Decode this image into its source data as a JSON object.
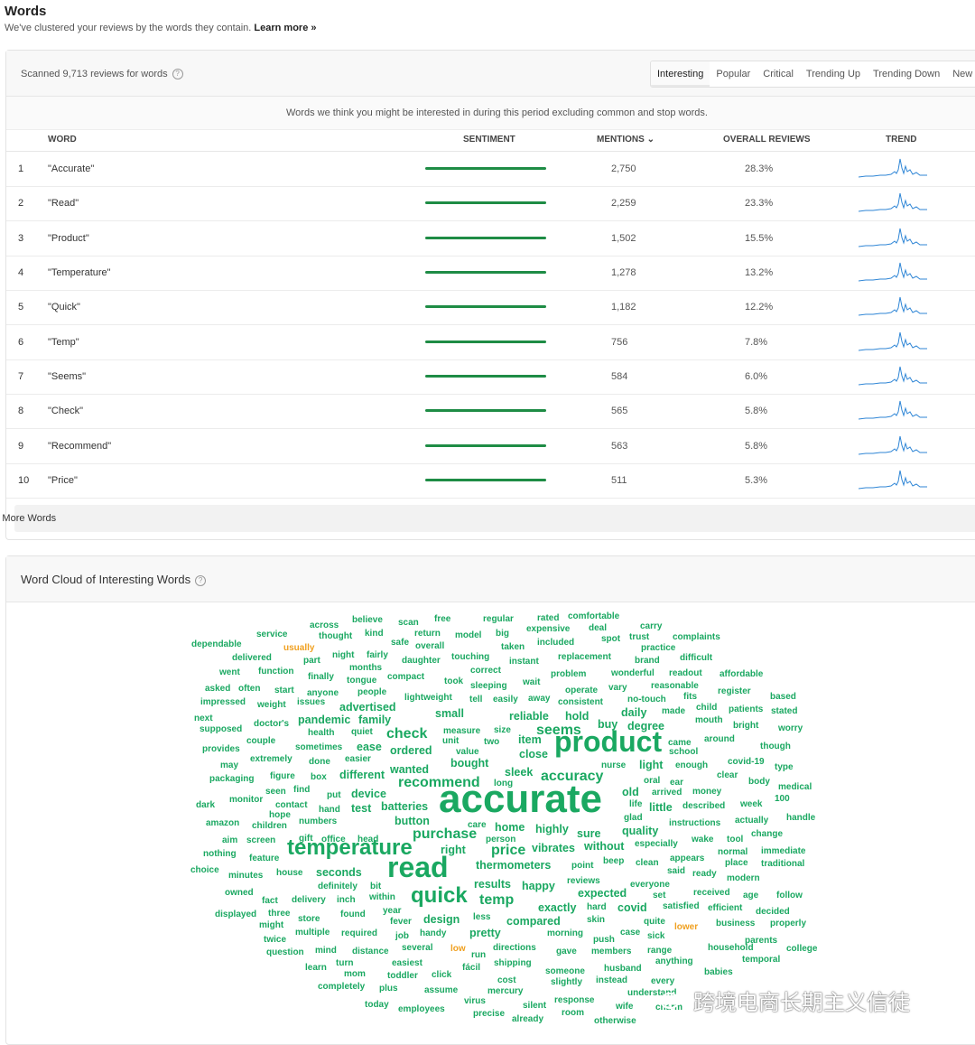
{
  "page": {
    "title": "Words",
    "subtitle": "We've clustered your reviews by the words they contain.",
    "learn_more": "Learn more »"
  },
  "words_panel": {
    "scanned": "Scanned 9,713 reviews for words",
    "help_glyph": "?",
    "tabs": [
      "Interesting",
      "Popular",
      "Critical",
      "Trending Up",
      "Trending Down",
      "New"
    ],
    "active_tab": "Interesting",
    "note": "Words we think you might be interested in during this period excluding common and stop words.",
    "headers": {
      "word": "WORD",
      "sentiment": "SENTIMENT",
      "mentions": "MENTIONS",
      "overall": "OVERALL REVIEWS",
      "trend": "TREND"
    },
    "sort_glyph": "⌄",
    "rows": [
      {
        "n": "1",
        "word": "\"Accurate\"",
        "sentiment": 1.0,
        "mentions": "2,750",
        "overall": "28.3%"
      },
      {
        "n": "2",
        "word": "\"Read\"",
        "sentiment": 1.0,
        "mentions": "2,259",
        "overall": "23.3%"
      },
      {
        "n": "3",
        "word": "\"Product\"",
        "sentiment": 1.0,
        "mentions": "1,502",
        "overall": "15.5%"
      },
      {
        "n": "4",
        "word": "\"Temperature\"",
        "sentiment": 1.0,
        "mentions": "1,278",
        "overall": "13.2%"
      },
      {
        "n": "5",
        "word": "\"Quick\"",
        "sentiment": 1.0,
        "mentions": "1,182",
        "overall": "12.2%"
      },
      {
        "n": "6",
        "word": "\"Temp\"",
        "sentiment": 1.0,
        "mentions": "756",
        "overall": "7.8%"
      },
      {
        "n": "7",
        "word": "\"Seems\"",
        "sentiment": 1.0,
        "mentions": "584",
        "overall": "6.0%"
      },
      {
        "n": "8",
        "word": "\"Check\"",
        "sentiment": 1.0,
        "mentions": "565",
        "overall": "5.8%"
      },
      {
        "n": "9",
        "word": "\"Recommend\"",
        "sentiment": 1.0,
        "mentions": "563",
        "overall": "5.8%"
      },
      {
        "n": "10",
        "word": "\"Price\"",
        "sentiment": 1.0,
        "mentions": "511",
        "overall": "5.3%"
      }
    ],
    "more_button": "Show More Words",
    "colors": {
      "sentiment": "#1e8c45",
      "trend": "#2f86d6"
    }
  },
  "cloud_panel": {
    "title": "Word Cloud of Interesting Words",
    "help_glyph": "?",
    "colors": {
      "positive": "#1aa861",
      "neutral": "#f0a020"
    },
    "words": [
      [
        "across",
        2,
        0
      ],
      [
        "believe",
        2,
        0
      ],
      [
        "scan",
        2,
        0
      ],
      [
        "free",
        2,
        0
      ],
      [
        "regular",
        2,
        0
      ],
      [
        "rated",
        2,
        0
      ],
      [
        "comfortable",
        2,
        0
      ],
      [
        "service",
        2,
        0
      ],
      [
        "thought",
        2,
        0
      ],
      [
        "kind",
        2,
        0
      ],
      [
        "return",
        2,
        0
      ],
      [
        "model",
        2,
        0
      ],
      [
        "big",
        2,
        0
      ],
      [
        "expensive",
        2,
        0
      ],
      [
        "deal",
        2,
        0
      ],
      [
        "carry",
        2,
        0
      ],
      [
        "dependable",
        2,
        0
      ],
      [
        "usually",
        2,
        1
      ],
      [
        "safe",
        2,
        0
      ],
      [
        "overall",
        2,
        0
      ],
      [
        "taken",
        2,
        0
      ],
      [
        "included",
        2,
        0
      ],
      [
        "spot",
        2,
        0
      ],
      [
        "trust",
        2,
        0
      ],
      [
        "complaints",
        2,
        0
      ],
      [
        "delivered",
        2,
        0
      ],
      [
        "night",
        2,
        0
      ],
      [
        "fairly",
        2,
        0
      ],
      [
        "daughter",
        2,
        0
      ],
      [
        "touching",
        2,
        0
      ],
      [
        "instant",
        2,
        0
      ],
      [
        "replacement",
        2,
        0
      ],
      [
        "practice",
        2,
        0
      ],
      [
        "went",
        2,
        0
      ],
      [
        "function",
        2,
        0
      ],
      [
        "months",
        2,
        0
      ],
      [
        "part",
        2,
        0
      ],
      [
        "correct",
        2,
        0
      ],
      [
        "brand",
        2,
        0
      ],
      [
        "difficult",
        2,
        0
      ],
      [
        "finally",
        2,
        0
      ],
      [
        "tongue",
        2,
        0
      ],
      [
        "compact",
        2,
        0
      ],
      [
        "problem",
        2,
        0
      ],
      [
        "wonderful",
        2,
        0
      ],
      [
        "readout",
        2,
        0
      ],
      [
        "affordable",
        2,
        0
      ],
      [
        "asked",
        2,
        0
      ],
      [
        "often",
        2,
        0
      ],
      [
        "start",
        2,
        0
      ],
      [
        "anyone",
        2,
        0
      ],
      [
        "people",
        2,
        0
      ],
      [
        "took",
        2,
        0
      ],
      [
        "sleeping",
        2,
        0
      ],
      [
        "wait",
        2,
        0
      ],
      [
        "operate",
        2,
        0
      ],
      [
        "vary",
        2,
        0
      ],
      [
        "reasonable",
        2,
        0
      ],
      [
        "register",
        2,
        0
      ],
      [
        "impressed",
        2,
        0
      ],
      [
        "weight",
        2,
        0
      ],
      [
        "issues",
        2,
        0
      ],
      [
        "lightweight",
        2,
        0
      ],
      [
        "tell",
        2,
        0
      ],
      [
        "easily",
        2,
        0
      ],
      [
        "away",
        2,
        0
      ],
      [
        "consistent",
        2,
        0
      ],
      [
        "no-touch",
        2,
        0
      ],
      [
        "fits",
        2,
        0
      ],
      [
        "based",
        2,
        0
      ],
      [
        "next",
        2,
        0
      ],
      [
        "pandemic",
        3,
        0
      ],
      [
        "family",
        3,
        0
      ],
      [
        "advertised",
        3,
        0
      ],
      [
        "small",
        3,
        0
      ],
      [
        "reliable",
        3,
        0
      ],
      [
        "hold",
        3,
        0
      ],
      [
        "daily",
        3,
        0
      ],
      [
        "made",
        2,
        0
      ],
      [
        "child",
        2,
        0
      ],
      [
        "patients",
        2,
        0
      ],
      [
        "stated",
        2,
        0
      ],
      [
        "supposed",
        2,
        0
      ],
      [
        "doctor's",
        2,
        0
      ],
      [
        "health",
        2,
        0
      ],
      [
        "quiet",
        2,
        0
      ],
      [
        "measure",
        2,
        0
      ],
      [
        "size",
        2,
        0
      ],
      [
        "buy",
        3,
        0
      ],
      [
        "degree",
        3,
        0
      ],
      [
        "mouth",
        2,
        0
      ],
      [
        "bright",
        2,
        0
      ],
      [
        "worry",
        2,
        0
      ],
      [
        "couple",
        2,
        0
      ],
      [
        "check",
        4,
        0
      ],
      [
        "unit",
        2,
        0
      ],
      [
        "two",
        2,
        0
      ],
      [
        "item",
        3,
        0
      ],
      [
        "seems",
        4,
        0
      ],
      [
        "came",
        2,
        0
      ],
      [
        "around",
        2,
        0
      ],
      [
        "provides",
        2,
        0
      ],
      [
        "sometimes",
        2,
        0
      ],
      [
        "ease",
        3,
        0
      ],
      [
        "ordered",
        3,
        0
      ],
      [
        "value",
        2,
        0
      ],
      [
        "close",
        3,
        0
      ],
      [
        "product",
        6,
        0
      ],
      [
        "school",
        2,
        0
      ],
      [
        "though",
        2,
        0
      ],
      [
        "extremely",
        2,
        0
      ],
      [
        "done",
        2,
        0
      ],
      [
        "easier",
        2,
        0
      ],
      [
        "bought",
        3,
        0
      ],
      [
        "nurse",
        2,
        0
      ],
      [
        "light",
        3,
        0
      ],
      [
        "enough",
        2,
        0
      ],
      [
        "covid-19",
        2,
        0
      ],
      [
        "may",
        2,
        0
      ],
      [
        "different",
        3,
        0
      ],
      [
        "wanted",
        3,
        0
      ],
      [
        "sleek",
        3,
        0
      ],
      [
        "accuracy",
        4,
        0
      ],
      [
        "clear",
        2,
        0
      ],
      [
        "type",
        2,
        0
      ],
      [
        "packaging",
        2,
        0
      ],
      [
        "figure",
        2,
        0
      ],
      [
        "box",
        2,
        0
      ],
      [
        "recommend",
        4,
        0
      ],
      [
        "long",
        2,
        0
      ],
      [
        "oral",
        2,
        0
      ],
      [
        "ear",
        2,
        0
      ],
      [
        "body",
        2,
        0
      ],
      [
        "medical",
        2,
        0
      ],
      [
        "seen",
        2,
        0
      ],
      [
        "find",
        2,
        0
      ],
      [
        "put",
        2,
        0
      ],
      [
        "device",
        3,
        0
      ],
      [
        "old",
        3,
        0
      ],
      [
        "arrived",
        2,
        0
      ],
      [
        "money",
        2,
        0
      ],
      [
        "dark",
        2,
        0
      ],
      [
        "monitor",
        2,
        0
      ],
      [
        "contact",
        2,
        0
      ],
      [
        "batteries",
        3,
        0
      ],
      [
        "life",
        2,
        0
      ],
      [
        "little",
        3,
        0
      ],
      [
        "described",
        2,
        0
      ],
      [
        "week",
        2,
        0
      ],
      [
        "100",
        2,
        0
      ],
      [
        "hope",
        2,
        0
      ],
      [
        "hand",
        2,
        0
      ],
      [
        "test",
        3,
        0
      ],
      [
        "accurate",
        7,
        0
      ],
      [
        "glad",
        2,
        0
      ],
      [
        "instructions",
        2,
        0
      ],
      [
        "actually",
        2,
        0
      ],
      [
        "handle",
        2,
        0
      ],
      [
        "amazon",
        2,
        0
      ],
      [
        "children",
        2,
        0
      ],
      [
        "numbers",
        2,
        0
      ],
      [
        "button",
        3,
        0
      ],
      [
        "home",
        3,
        0
      ],
      [
        "care",
        2,
        0
      ],
      [
        "highly",
        3,
        0
      ],
      [
        "quality",
        3,
        0
      ],
      [
        "change",
        2,
        0
      ],
      [
        "aim",
        2,
        0
      ],
      [
        "screen",
        2,
        0
      ],
      [
        "gift",
        2,
        0
      ],
      [
        "office",
        2,
        0
      ],
      [
        "head",
        2,
        0
      ],
      [
        "purchase",
        4,
        0
      ],
      [
        "person",
        2,
        0
      ],
      [
        "sure",
        3,
        0
      ],
      [
        "especially",
        2,
        0
      ],
      [
        "wake",
        2,
        0
      ],
      [
        "tool",
        2,
        0
      ],
      [
        "nothing",
        2,
        0
      ],
      [
        "feature",
        2,
        0
      ],
      [
        "temperature",
        5,
        0
      ],
      [
        "right",
        3,
        0
      ],
      [
        "price",
        4,
        0
      ],
      [
        "vibrates",
        3,
        0
      ],
      [
        "without",
        3,
        0
      ],
      [
        "normal",
        2,
        0
      ],
      [
        "immediate",
        2,
        0
      ],
      [
        "choice",
        2,
        0
      ],
      [
        "minutes",
        2,
        0
      ],
      [
        "house",
        2,
        0
      ],
      [
        "seconds",
        3,
        0
      ],
      [
        "thermometers",
        3,
        0
      ],
      [
        "point",
        2,
        0
      ],
      [
        "beep",
        2,
        0
      ],
      [
        "clean",
        2,
        0
      ],
      [
        "appears",
        2,
        0
      ],
      [
        "place",
        2,
        0
      ],
      [
        "traditional",
        2,
        0
      ],
      [
        "owned",
        2,
        0
      ],
      [
        "definitely",
        2,
        0
      ],
      [
        "bit",
        2,
        0
      ],
      [
        "read",
        6,
        0
      ],
      [
        "reviews",
        2,
        0
      ],
      [
        "said",
        2,
        0
      ],
      [
        "ready",
        2,
        0
      ],
      [
        "modern",
        2,
        0
      ],
      [
        "fact",
        2,
        0
      ],
      [
        "delivery",
        2,
        0
      ],
      [
        "inch",
        2,
        0
      ],
      [
        "within",
        2,
        0
      ],
      [
        "quick",
        5,
        0
      ],
      [
        "results",
        3,
        0
      ],
      [
        "happy",
        3,
        0
      ],
      [
        "everyone",
        2,
        0
      ],
      [
        "received",
        2,
        0
      ],
      [
        "age",
        2,
        0
      ],
      [
        "follow",
        2,
        0
      ],
      [
        "displayed",
        2,
        0
      ],
      [
        "three",
        2,
        0
      ],
      [
        "store",
        2,
        0
      ],
      [
        "found",
        2,
        0
      ],
      [
        "year",
        2,
        0
      ],
      [
        "temp",
        4,
        0
      ],
      [
        "expected",
        3,
        0
      ],
      [
        "set",
        2,
        0
      ],
      [
        "satisfied",
        2,
        0
      ],
      [
        "efficient",
        2,
        0
      ],
      [
        "decided",
        2,
        0
      ],
      [
        "might",
        2,
        0
      ],
      [
        "fever",
        2,
        0
      ],
      [
        "design",
        3,
        0
      ],
      [
        "less",
        2,
        0
      ],
      [
        "exactly",
        3,
        0
      ],
      [
        "hard",
        2,
        0
      ],
      [
        "covid",
        3,
        0
      ],
      [
        "quite",
        2,
        0
      ],
      [
        "business",
        2,
        0
      ],
      [
        "properly",
        2,
        0
      ],
      [
        "twice",
        2,
        0
      ],
      [
        "multiple",
        2,
        0
      ],
      [
        "required",
        2,
        0
      ],
      [
        "job",
        2,
        0
      ],
      [
        "handy",
        2,
        0
      ],
      [
        "compared",
        3,
        0
      ],
      [
        "skin",
        2,
        0
      ],
      [
        "lower",
        2,
        1
      ],
      [
        "question",
        2,
        0
      ],
      [
        "mind",
        2,
        0
      ],
      [
        "distance",
        2,
        0
      ],
      [
        "several",
        2,
        0
      ],
      [
        "low",
        2,
        1
      ],
      [
        "pretty",
        3,
        0
      ],
      [
        "morning",
        2,
        0
      ],
      [
        "case",
        2,
        0
      ],
      [
        "sick",
        2,
        0
      ],
      [
        "parents",
        2,
        0
      ],
      [
        "learn",
        2,
        0
      ],
      [
        "turn",
        2,
        0
      ],
      [
        "easiest",
        2,
        0
      ],
      [
        "run",
        2,
        0
      ],
      [
        "directions",
        2,
        0
      ],
      [
        "push",
        2,
        0
      ],
      [
        "gave",
        2,
        0
      ],
      [
        "members",
        2,
        0
      ],
      [
        "range",
        2,
        0
      ],
      [
        "household",
        2,
        0
      ],
      [
        "college",
        2,
        0
      ],
      [
        "mom",
        2,
        0
      ],
      [
        "toddler",
        2,
        0
      ],
      [
        "fácil",
        2,
        0
      ],
      [
        "shipping",
        2,
        0
      ],
      [
        "someone",
        2,
        0
      ],
      [
        "husband",
        2,
        0
      ],
      [
        "anything",
        2,
        0
      ],
      [
        "temporal",
        2,
        0
      ],
      [
        "completely",
        2,
        0
      ],
      [
        "plus",
        2,
        0
      ],
      [
        "click",
        2,
        0
      ],
      [
        "cost",
        2,
        0
      ],
      [
        "slightly",
        2,
        0
      ],
      [
        "instead",
        2,
        0
      ],
      [
        "every",
        2,
        0
      ],
      [
        "babies",
        2,
        0
      ],
      [
        "assume",
        2,
        0
      ],
      [
        "mercury",
        2,
        0
      ],
      [
        "understand",
        2,
        0
      ],
      [
        "today",
        2,
        0
      ],
      [
        "employees",
        2,
        0
      ],
      [
        "virus",
        2,
        0
      ],
      [
        "silent",
        2,
        0
      ],
      [
        "response",
        2,
        0
      ],
      [
        "wife",
        2,
        0
      ],
      [
        "charm",
        2,
        0
      ],
      [
        "precise",
        2,
        0
      ],
      [
        "already",
        2,
        0
      ],
      [
        "room",
        2,
        0
      ],
      [
        "otherwise",
        2,
        0
      ]
    ]
  },
  "watermark": "跨境电商长期主义信徒"
}
